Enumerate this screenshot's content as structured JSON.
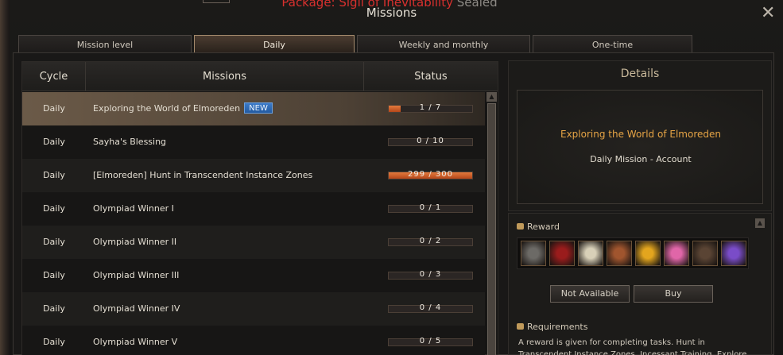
{
  "window": {
    "banner_red": "Package: Sigil of Inevitability",
    "banner_grey": "Sealed",
    "title": "Missions",
    "close_label": "✕"
  },
  "tabs": [
    {
      "label": "Mission level",
      "active": false
    },
    {
      "label": "Daily",
      "active": true
    },
    {
      "label": "Weekly and monthly",
      "active": false
    },
    {
      "label": "One-time",
      "active": false
    }
  ],
  "list": {
    "headers": {
      "cycle": "Cycle",
      "missions": "Missions",
      "status": "Status"
    },
    "rows": [
      {
        "cycle": "Daily",
        "name": "Exploring the World of Elmoreden",
        "badge": "NEW",
        "progress": "1 / 7",
        "current": 1,
        "total": 7,
        "selected": true
      },
      {
        "cycle": "Daily",
        "name": "Sayha's Blessing",
        "badge": "",
        "progress": "0 / 10",
        "current": 0,
        "total": 10,
        "selected": false
      },
      {
        "cycle": "Daily",
        "name": "[Elmoreden] Hunt in Transcendent Instance Zones",
        "badge": "",
        "progress": "299 / 300",
        "current": 299,
        "total": 300,
        "selected": false
      },
      {
        "cycle": "Daily",
        "name": "Olympiad Winner I",
        "badge": "",
        "progress": "0 / 1",
        "current": 0,
        "total": 1,
        "selected": false
      },
      {
        "cycle": "Daily",
        "name": "Olympiad Winner II",
        "badge": "",
        "progress": "0 / 2",
        "current": 0,
        "total": 2,
        "selected": false
      },
      {
        "cycle": "Daily",
        "name": "Olympiad Winner III",
        "badge": "",
        "progress": "0 / 3",
        "current": 0,
        "total": 3,
        "selected": false
      },
      {
        "cycle": "Daily",
        "name": "Olympiad Winner IV",
        "badge": "",
        "progress": "0 / 4",
        "current": 0,
        "total": 4,
        "selected": false
      },
      {
        "cycle": "Daily",
        "name": "Olympiad Winner V",
        "badge": "",
        "progress": "0 / 5",
        "current": 0,
        "total": 5,
        "selected": false
      }
    ]
  },
  "details": {
    "title": "Details",
    "mission_name": "Exploring the World of Elmoreden",
    "mission_type": "Daily Mission  -  Account",
    "reward_label": "Reward",
    "reward_items": [
      {
        "icon": "statue-icon",
        "color": "#6c6a66"
      },
      {
        "icon": "red-gem-icon",
        "color": "#9a1c1c"
      },
      {
        "icon": "scroll-icon",
        "color": "#d8d0b8"
      },
      {
        "icon": "ornate-disc-icon",
        "color": "#a0552e"
      },
      {
        "icon": "l-coin-icon",
        "color": "#e3a51e"
      },
      {
        "icon": "pink-ticket-icon",
        "color": "#e066a8"
      },
      {
        "icon": "armor-icon",
        "color": "#5a4434"
      },
      {
        "icon": "purple-cauldron-icon",
        "color": "#7a4cc8"
      }
    ],
    "not_available_label": "Not Available",
    "buy_label": "Buy",
    "requirements_label": "Requirements",
    "requirements_text": "A reward is given for completing tasks. Hunt in Transcendent Instance Zones, Incessant Training, Explore"
  },
  "colors": {
    "accent_orange": "#e6a445",
    "progress_fill": "#d0612a",
    "new_badge": "#2f6bb8",
    "banner_red": "#d8302e"
  }
}
